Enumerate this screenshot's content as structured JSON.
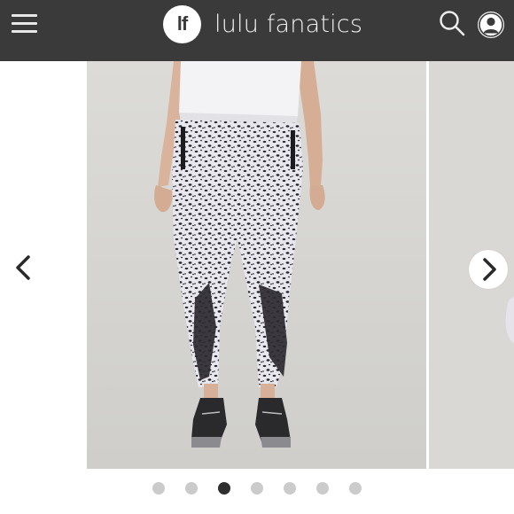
{
  "header": {
    "logo_text": "lf",
    "brand_name": "lulu fanatics",
    "background_color": "#3a3a3a"
  },
  "icons": {
    "menu": "hamburger-menu-icon",
    "search": "search-icon",
    "account": "user-account-icon",
    "prev": "chevron-left-icon",
    "next": "chevron-right-icon"
  },
  "carousel": {
    "slide_count": 7,
    "active_index": 2
  }
}
